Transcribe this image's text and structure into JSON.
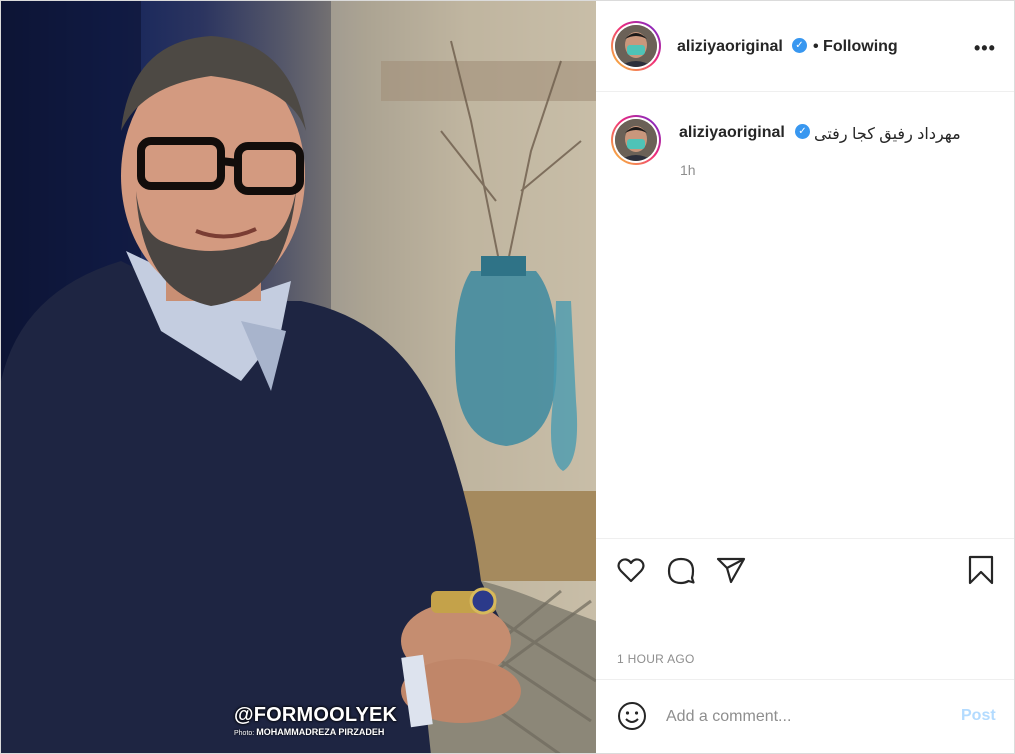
{
  "post": {
    "watermark": "@FORMOOLYEK",
    "photo_credit_label": "Photo:",
    "photo_credit_name": "MOHAMMADREZA PIRZADEH"
  },
  "header": {
    "username": "aliziyaoriginal",
    "follow_status": "• Following",
    "more_label": "•••"
  },
  "comment": {
    "username": "aliziyaoriginal",
    "caption": "مهرداد رفیق کجا رفتی",
    "time": "1h"
  },
  "actions": {
    "like": "heart-icon",
    "comment": "comment-bubble-icon",
    "share": "paper-plane-icon",
    "save": "bookmark-icon"
  },
  "timestamp": "1 HOUR AGO",
  "add_comment": {
    "placeholder": "Add a comment...",
    "post_label": "Post"
  },
  "colors": {
    "verified": "#3897f0",
    "post_button": "#b3dbff",
    "muted_text": "#8e8e8e"
  }
}
